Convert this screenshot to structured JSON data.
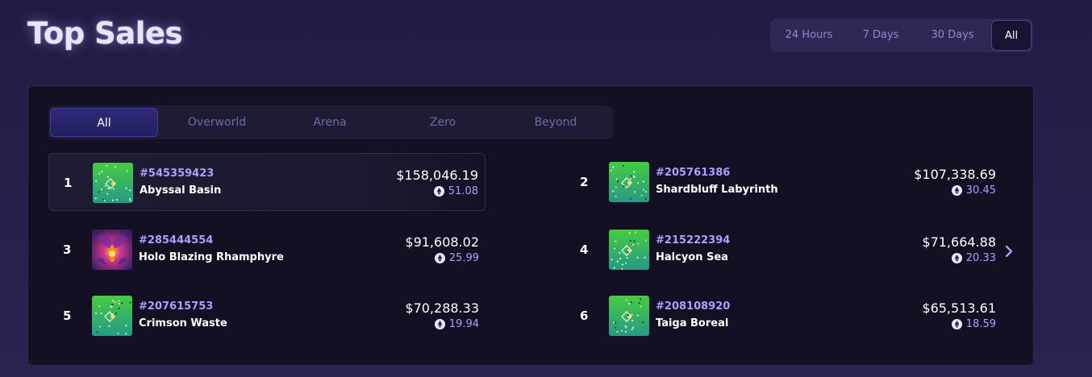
{
  "page_title": "Top Sales",
  "time_ranges": [
    "24 Hours",
    "7 Days",
    "30 Days",
    "All"
  ],
  "time_range_selected": "All",
  "categories": [
    "All",
    "Overworld",
    "Arena",
    "Zero",
    "Beyond"
  ],
  "category_selected": "All",
  "sales": [
    {
      "rank": "1",
      "token_id": "#545359423",
      "name": "Abyssal Basin",
      "usd": "$158,046.19",
      "eth": "51.08",
      "thumb": "land"
    },
    {
      "rank": "2",
      "token_id": "#205761386",
      "name": "Shardbluff Labyrinth",
      "usd": "$107,338.69",
      "eth": "30.45",
      "thumb": "land"
    },
    {
      "rank": "3",
      "token_id": "#285444554",
      "name": "Holo Blazing Rhamphyre",
      "usd": "$91,608.02",
      "eth": "25.99",
      "thumb": "creature"
    },
    {
      "rank": "4",
      "token_id": "#215222394",
      "name": "Halcyon Sea",
      "usd": "$71,664.88",
      "eth": "20.33",
      "thumb": "land"
    },
    {
      "rank": "5",
      "token_id": "#207615753",
      "name": "Crimson Waste",
      "usd": "$70,288.33",
      "eth": "19.94",
      "thumb": "land"
    },
    {
      "rank": "6",
      "token_id": "#208108920",
      "name": "Taiga Boreal",
      "usd": "$65,513.61",
      "eth": "18.59",
      "thumb": "land"
    }
  ],
  "icons": {
    "currency": "eth-coin-icon",
    "next": "chevron-right-icon"
  },
  "colors": {
    "accent": "#a9a2ff",
    "active_tab": "#2a2570",
    "land_green": "#3dc24a",
    "land_teal": "#2a9e86"
  }
}
